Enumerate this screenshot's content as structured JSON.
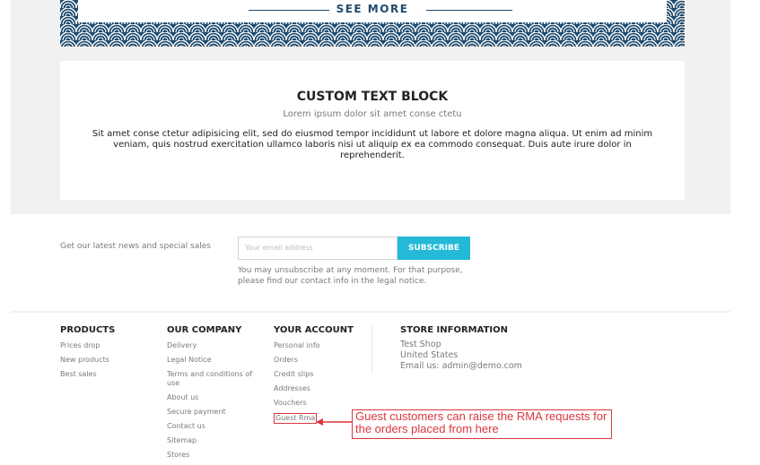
{
  "banner": {
    "see_more": "SEE MORE"
  },
  "custom_text_block": {
    "title": "CUSTOM TEXT BLOCK",
    "subtitle": "Lorem ipsum dolor sit amet conse ctetu",
    "body": "Sit amet conse ctetur adipisicing elit, sed do eiusmod tempor incididunt ut labore et dolore magna aliqua. Ut enim ad minim veniam, quis nostrud exercitation ullamco laboris nisi ut aliquip ex ea commodo consequat. Duis aute irure dolor in reprehenderit."
  },
  "newsletter": {
    "label": "Get our latest news and special sales",
    "email_placeholder": "Your email address",
    "subscribe_label": "SUBSCRIBE",
    "note": "You may unsubscribe at any moment. For that purpose, please find our contact info in the legal notice."
  },
  "footer": {
    "products": {
      "title": "PRODUCTS",
      "links": [
        "Prices drop",
        "New products",
        "Best sales"
      ]
    },
    "company": {
      "title": "OUR COMPANY",
      "links": [
        "Delivery",
        "Legal Notice",
        "Terms and conditions of use",
        "About us",
        "Secure payment",
        "Contact us",
        "Sitemap",
        "Stores"
      ]
    },
    "account": {
      "title": "YOUR ACCOUNT",
      "links": [
        "Personal info",
        "Orders",
        "Credit slips",
        "Addresses",
        "Vouchers",
        "Guest Rma"
      ]
    },
    "store": {
      "title": "STORE INFORMATION",
      "lines": [
        "Test Shop",
        "United States",
        "Email us: admin@demo.com"
      ]
    }
  },
  "annotation": {
    "text": "Guest customers can raise the RMA requests for the orders placed from here"
  },
  "colors": {
    "accent": "#24b9d7",
    "banner": "#1e4a6e",
    "annotation": "#d9363e"
  }
}
